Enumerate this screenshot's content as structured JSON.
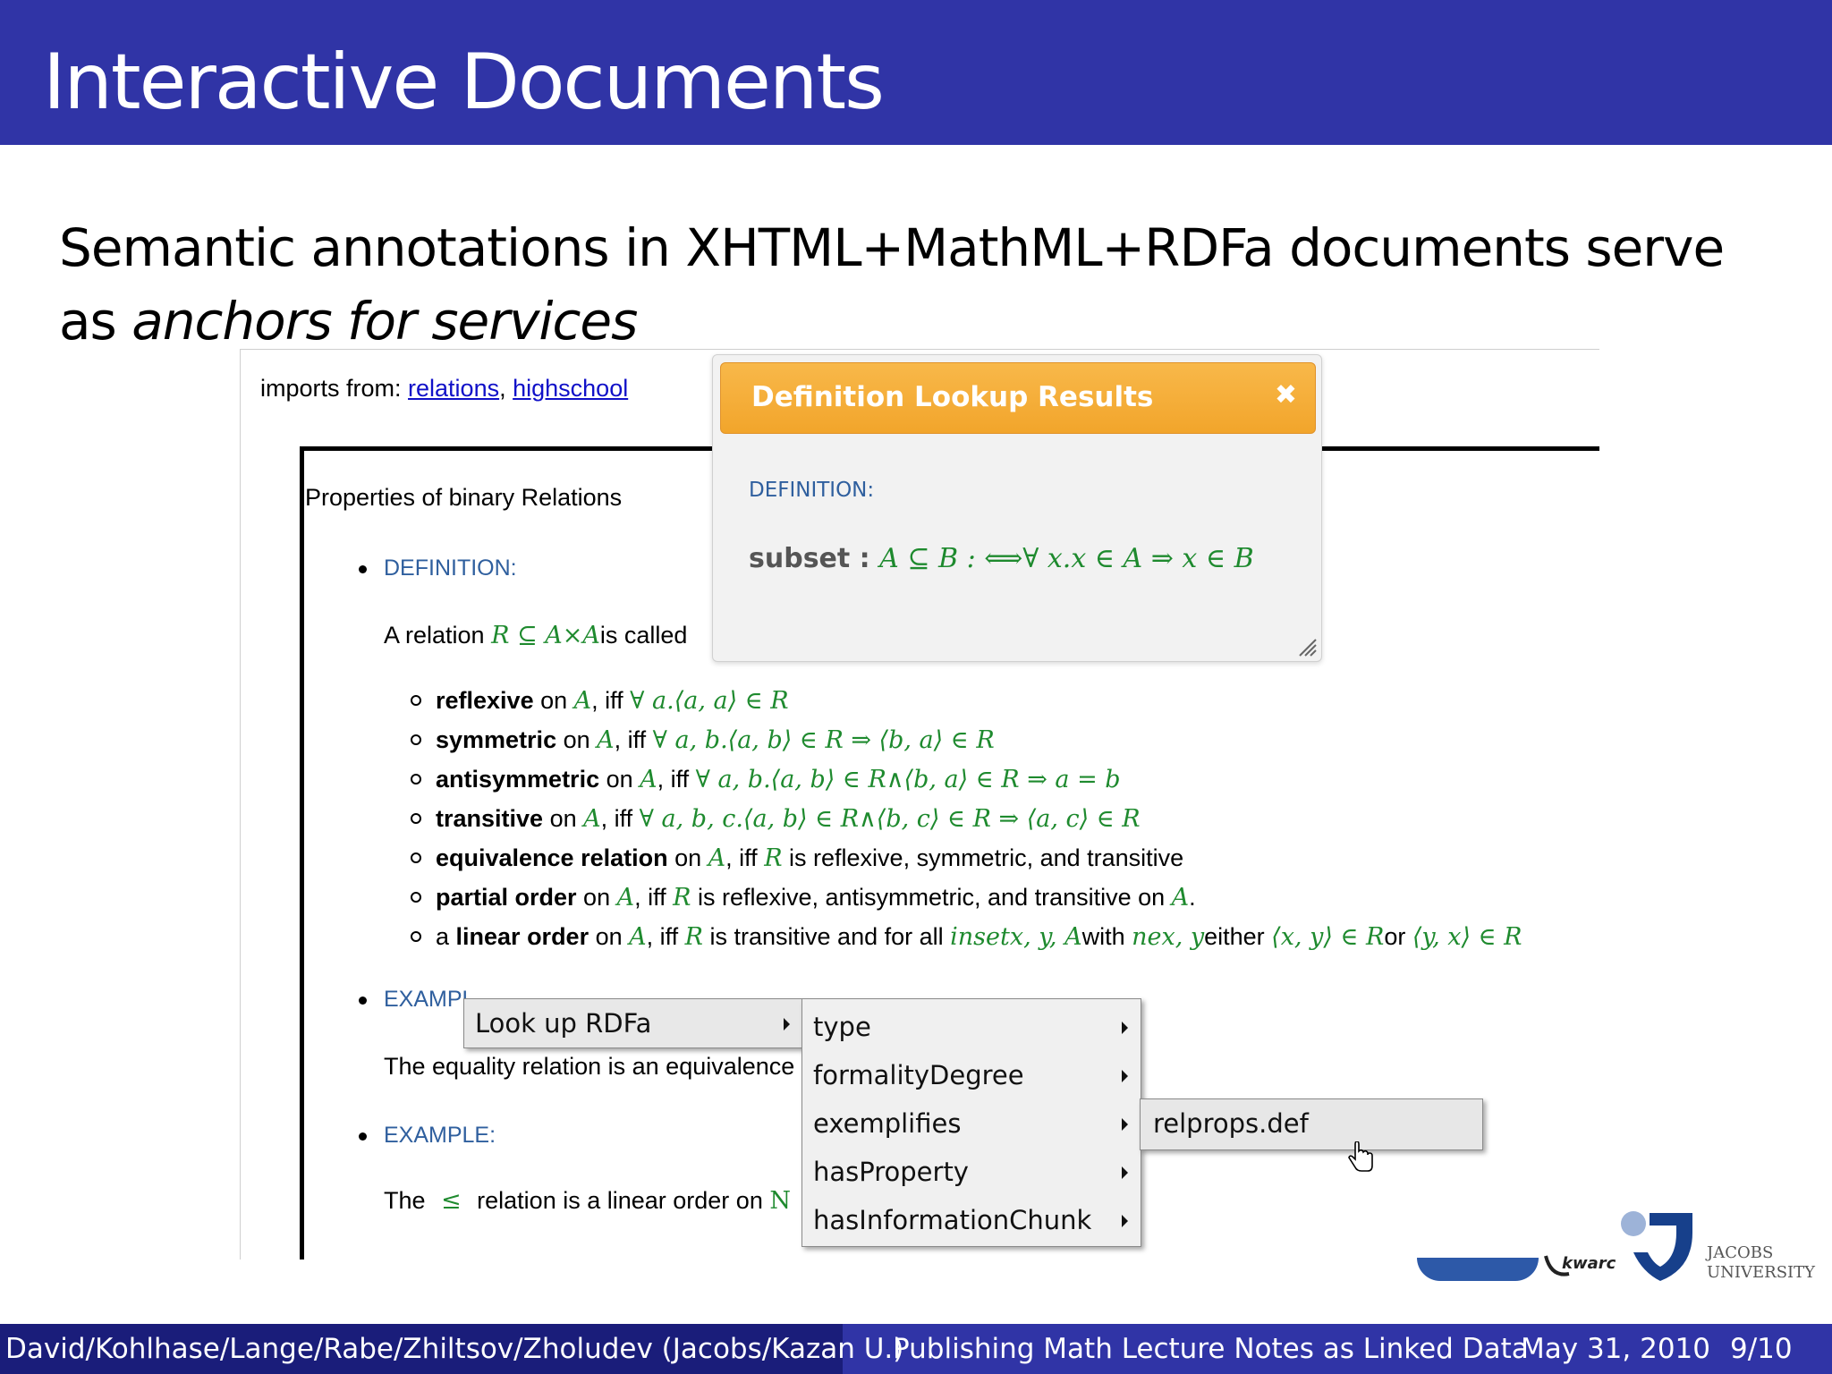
{
  "slide": {
    "title": "Interactive Documents",
    "lead_line1": "Semantic annotations in XHTML+MathML+RDFa documents serve",
    "lead_line2_prefix": "as ",
    "lead_line2_emph": "anchors for services"
  },
  "document": {
    "imports_label": "imports from: ",
    "imports_links": [
      "relations",
      "highschool"
    ],
    "imports_sep": ", ",
    "section_title": "Properties of binary Relations",
    "definition_label": "DEFINITION:",
    "relation_prefix": "A relation ",
    "relation_math": "R ⊆ A×A",
    "relation_suffix": "is called",
    "properties": [
      {
        "term": "reflexive",
        "on": " on ",
        "set": "A",
        "iff": ", iff ",
        "formula": "∀ a.⟨a, a⟩ ∈ R"
      },
      {
        "term": "symmetric",
        "on": " on ",
        "set": "A",
        "iff": ", iff ",
        "formula": "∀ a, b.⟨a, b⟩ ∈ R ⇒ ⟨b, a⟩ ∈ R"
      },
      {
        "term": "antisymmetric",
        "on": " on ",
        "set": "A",
        "iff": ", iff ",
        "formula": "∀ a, b.⟨a, b⟩ ∈ R∧⟨b, a⟩ ∈ R ⇒ a = b"
      },
      {
        "term": "transitive",
        "on": " on ",
        "set": "A",
        "iff": ", iff ",
        "formula": "∀ a, b, c.⟨a, b⟩ ∈ R∧⟨b, c⟩ ∈ R ⇒ ⟨a, c⟩ ∈ R"
      }
    ],
    "equivalence": {
      "term": "equivalence relation",
      "on": " on ",
      "set": "A",
      "iff": ", iff ",
      "rel": "R",
      "rest": " is reflexive, symmetric, and transitive"
    },
    "partial": {
      "term": "partial order",
      "on": " on ",
      "set": "A",
      "iff": ", iff ",
      "rel": "R",
      "rest": " is reflexive, antisymmetric, and transitive on ",
      "set2": "A",
      "end": "."
    },
    "linear": {
      "prefix": "a ",
      "term": "linear order",
      "on": " on ",
      "set": "A",
      "iff": ", iff ",
      "rel": "R",
      "mid": " is transitive and for all ",
      "m1": "insetx, y, A",
      "with": "with ",
      "m2": "nex, y",
      "either": "either ",
      "m3": "⟨x, y⟩ ∈ R",
      "or": "or ",
      "m4": "⟨y, x⟩ ∈ R"
    },
    "example_label_1": "EXAMPL",
    "example_text_1": "The equality relation is an equivalence",
    "example_label_2": "EXAMPLE:",
    "example_text_2_prefix": "The ",
    "example_text_2_math": "≤",
    "example_text_2_suffix": " relation is a linear order on ",
    "example_text_2_set": "N"
  },
  "popup": {
    "title": "Definition Lookup Results",
    "close": "✖",
    "label": "DEFINITION:",
    "term": "subset",
    "colon": " : ",
    "formula": "A ⊆ B : ⟺∀ x.x ∈ A ⇒ x ∈ B"
  },
  "context_menu": {
    "root": "Look up RDFa",
    "items": [
      "type",
      "formalityDegree",
      "exemplifies",
      "hasProperty",
      "hasInformationChunk"
    ],
    "sub_item": "relprops.def"
  },
  "logos": {
    "jacobs_line1": "JACOBS",
    "jacobs_line2": "UNIVERSITY"
  },
  "footer": {
    "authors": "David/Kohlhase/Lange/Rabe/Zhiltsov/Zholudev  (Jacobs/Kazan U.)",
    "talk": "Publishing Math Lecture Notes as Linked Data",
    "date": "May 31, 2010",
    "page": "9/10"
  },
  "colors": {
    "title_bar": "#3034a6",
    "footer_dark": "#1a1d7a",
    "popup_header": "#f2a52b",
    "math_green": "#1e8a2e",
    "label_blue": "#2f5f9e"
  }
}
